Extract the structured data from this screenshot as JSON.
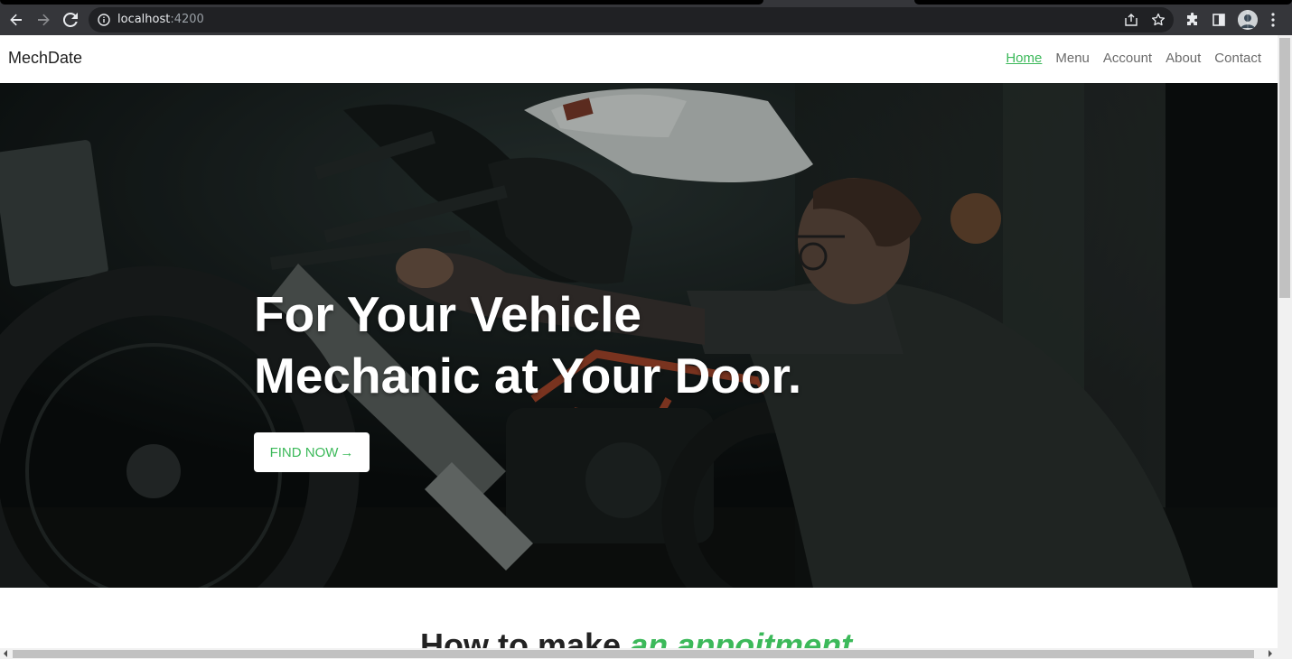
{
  "browser": {
    "url_host": "localhost",
    "url_port": ":4200"
  },
  "site": {
    "brand": "MechDate",
    "nav": [
      {
        "label": "Home",
        "active": true
      },
      {
        "label": "Menu",
        "active": false
      },
      {
        "label": "Account",
        "active": false
      },
      {
        "label": "About",
        "active": false
      },
      {
        "label": "Contact",
        "active": false
      }
    ]
  },
  "hero": {
    "title_line1": "For Your Vehicle",
    "title_line2": "Mechanic at Your Door.",
    "cta_label": "FIND NOW",
    "cta_arrow": "→"
  },
  "section": {
    "heading_plain": "How to make ",
    "heading_accent": "an appoitment"
  },
  "colors": {
    "accent": "#3cb95a",
    "nav_text": "#6b6b6b",
    "chrome_dark": "#202124",
    "chrome_toolbar": "#35363a"
  },
  "icons": {
    "back": "back-arrow-icon",
    "forward": "forward-arrow-icon",
    "reload": "reload-icon",
    "site_info": "info-icon",
    "share": "share-icon",
    "bookmark": "star-icon",
    "extensions": "puzzle-icon",
    "side_panel": "side-panel-icon",
    "profile": "avatar",
    "menu": "kebab-menu-icon"
  }
}
